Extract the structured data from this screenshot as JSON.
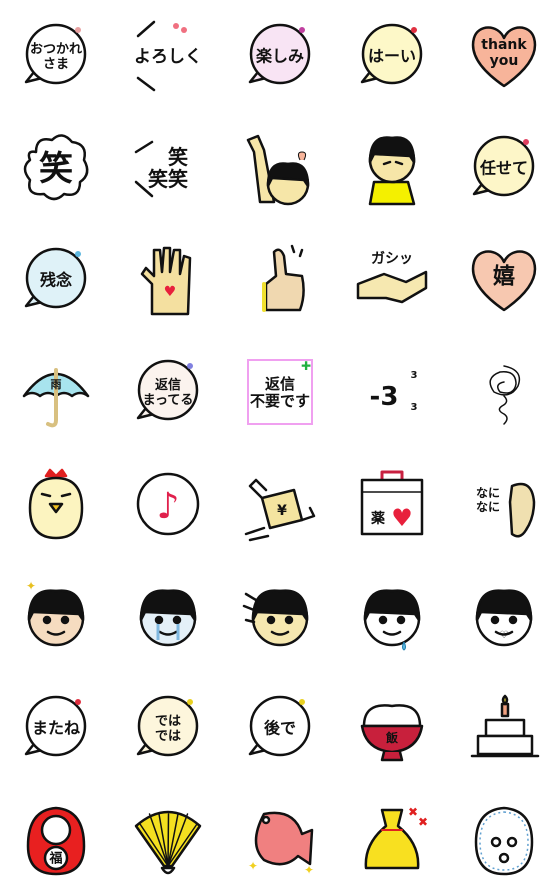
{
  "stickers": [
    {
      "kind": "bubble",
      "text": [
        "おつかれ",
        "さま"
      ],
      "fill": "#ffffff",
      "accent": "#e8a0a0"
    },
    {
      "kind": "plain",
      "text": [
        "よろしく"
      ],
      "fill": "#ffffff",
      "accent": "#f07080"
    },
    {
      "kind": "bubble",
      "text": [
        "楽しみ"
      ],
      "fill": "#f8e4f4",
      "accent": "#c040a0"
    },
    {
      "kind": "bubble",
      "text": [
        "はーい"
      ],
      "fill": "#fdf8c8",
      "accent": "#e03040"
    },
    {
      "kind": "heart",
      "text": [
        "thank",
        "you"
      ],
      "fill": "#f7b49a"
    },
    {
      "kind": "cloud",
      "text": [
        "笑"
      ],
      "fill": "#ffffff"
    },
    {
      "kind": "plain",
      "text": [
        "　笑",
        "笑笑"
      ],
      "fill": "#ffffff"
    },
    {
      "kind": "icon",
      "icon": "girl-waving-icon",
      "fill": "#f6e6a8"
    },
    {
      "kind": "icon",
      "icon": "girl-yellow-shirt-icon",
      "fill": "#f6e6a8",
      "accent": "#f4f000"
    },
    {
      "kind": "bubble",
      "text": [
        "任せて"
      ],
      "fill": "#fdf6c8",
      "accent": "#e04060"
    },
    {
      "kind": "bubble",
      "text": [
        "残念"
      ],
      "fill": "#dff2f8",
      "accent": "#60b8e0"
    },
    {
      "kind": "icon",
      "icon": "raised-hand-heart-icon",
      "fill": "#f4e0a0",
      "accent": "#e8203c"
    },
    {
      "kind": "icon",
      "icon": "thumbs-up-icon",
      "fill": "#f0d8b0",
      "accent": "#f0e030"
    },
    {
      "kind": "icon",
      "icon": "handshake-icon",
      "text": [
        "ガシッ"
      ],
      "fill": "#f6e8b0"
    },
    {
      "kind": "heart",
      "text": [
        "嬉"
      ],
      "fill": "#f7c8b0"
    },
    {
      "kind": "icon",
      "icon": "umbrella-icon",
      "text": [
        "雨"
      ],
      "fill": "#a8e4ee"
    },
    {
      "kind": "bubble",
      "text": [
        "返信",
        "まってる"
      ],
      "fill": "#fbf3ee",
      "accent": "#8080e0"
    },
    {
      "kind": "square",
      "text": [
        "返信",
        "不要です"
      ],
      "fill": "#ffffff",
      "accent": "#f0a0f0"
    },
    {
      "kind": "icon",
      "icon": "sigh-icon",
      "text": [
        "-3"
      ],
      "fill": "#ffffff"
    },
    {
      "kind": "icon",
      "icon": "scribble-icon",
      "fill": "#ffffff"
    },
    {
      "kind": "icon",
      "icon": "chick-icon",
      "fill": "#fcf4c0",
      "accent": "#e02020"
    },
    {
      "kind": "icon",
      "icon": "music-note-icon",
      "fill": "#ffffff",
      "accent": "#e0204c"
    },
    {
      "kind": "icon",
      "icon": "flying-money-icon",
      "text": [
        "¥"
      ],
      "fill": "#f4e4a0"
    },
    {
      "kind": "icon",
      "icon": "medicine-box-icon",
      "text": [
        "薬"
      ],
      "fill": "#ffffff",
      "accent": "#e8203c"
    },
    {
      "kind": "icon",
      "icon": "ear-icon",
      "text": [
        "なに",
        "なに"
      ],
      "fill": "#f0e0b0"
    },
    {
      "kind": "face",
      "icon": "girl-sparkle-eyes-icon",
      "fill": "#f6dcc0"
    },
    {
      "kind": "face",
      "icon": "girl-crying-icon",
      "fill": "#e4f0f8"
    },
    {
      "kind": "face",
      "icon": "girl-shocked-icon",
      "fill": "#f6e8b0"
    },
    {
      "kind": "face",
      "icon": "girl-sweat-icon",
      "fill": "#ffffff"
    },
    {
      "kind": "face",
      "icon": "girl-love-icon",
      "fill": "#ffffff"
    },
    {
      "kind": "bubble",
      "text": [
        "またね"
      ],
      "fill": "#ffffff",
      "accent": "#e03040"
    },
    {
      "kind": "bubble",
      "text": [
        "では",
        "では"
      ],
      "fill": "#fdf6dc",
      "accent": "#e8d020"
    },
    {
      "kind": "bubble",
      "text": [
        "後で"
      ],
      "fill": "#ffffff",
      "accent": "#e8d020"
    },
    {
      "kind": "icon",
      "icon": "rice-bowl-icon",
      "text": [
        "飯"
      ],
      "fill": "#c8203c"
    },
    {
      "kind": "icon",
      "icon": "birthday-cake-icon",
      "fill": "#ffffff",
      "accent": "#f0a080"
    },
    {
      "kind": "icon",
      "icon": "daruma-icon",
      "text": [
        "福"
      ],
      "fill": "#e82020"
    },
    {
      "kind": "icon",
      "icon": "folding-fan-icon",
      "fill": "#f4e020"
    },
    {
      "kind": "icon",
      "icon": "sea-bream-icon",
      "fill": "#f08080",
      "accent": "#f0d020"
    },
    {
      "kind": "icon",
      "icon": "lucky-bag-icon",
      "fill": "#f8e020",
      "accent": "#e02020"
    },
    {
      "kind": "icon",
      "icon": "hooded-face-icon",
      "fill": "#ffffff",
      "accent": "#60a0d0"
    }
  ]
}
